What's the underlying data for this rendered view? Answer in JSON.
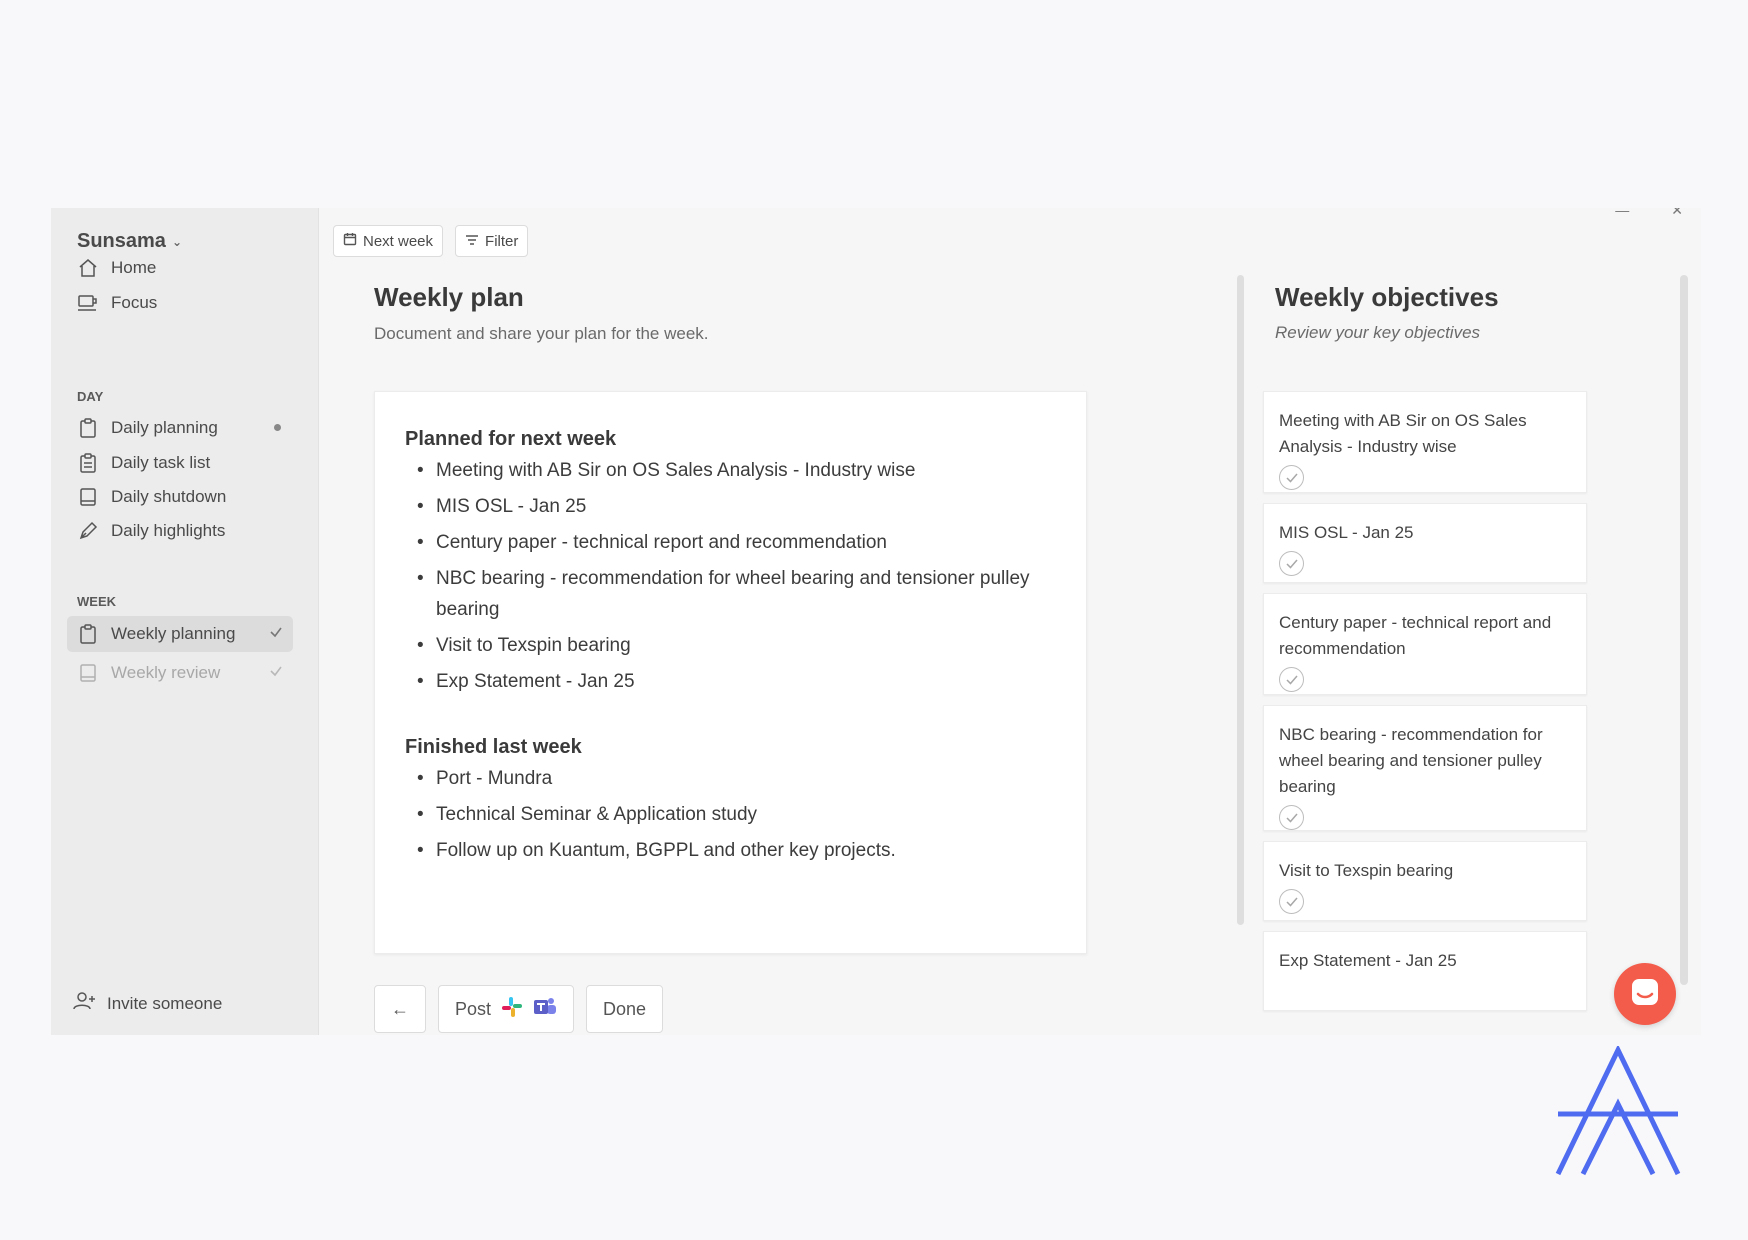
{
  "window": {
    "minimize_glyph": "—",
    "close_glyph": "✕"
  },
  "sidebar": {
    "brand": "Sunsama",
    "brand_chevron": "⌄",
    "items_top": [
      {
        "label": "Home",
        "icon": "home-icon"
      },
      {
        "label": "Focus",
        "icon": "cup-icon"
      }
    ],
    "day_label": "DAY",
    "day_items": [
      {
        "label": "Daily planning",
        "icon": "clipboard-icon",
        "badge": "dot"
      },
      {
        "label": "Daily task list",
        "icon": "checklist-icon"
      },
      {
        "label": "Daily shutdown",
        "icon": "book-icon"
      },
      {
        "label": "Daily highlights",
        "icon": "pen-icon"
      }
    ],
    "week_label": "WEEK",
    "week_items": [
      {
        "label": "Weekly planning",
        "icon": "clipboard-icon",
        "status": "check",
        "active": true
      },
      {
        "label": "Weekly review",
        "icon": "book-icon",
        "status": "check",
        "muted": true
      }
    ],
    "invite_label": "Invite someone"
  },
  "toolbar": {
    "next_week_label": "Next week",
    "filter_label": "Filter"
  },
  "plan": {
    "title": "Weekly plan",
    "subtitle": "Document and share your plan for the week.",
    "planned_heading": "Planned for next week",
    "planned_items": [
      "Meeting with AB Sir on OS Sales Analysis - Industry wise",
      "MIS OSL - Jan 25",
      "Century paper - technical report and recommendation",
      "NBC bearing - recommendation for wheel bearing and tensioner pulley bearing",
      "Visit to Texspin bearing",
      "Exp Statement - Jan 25"
    ],
    "finished_heading": "Finished last week",
    "finished_items": [
      "Port - Mundra",
      "Technical Seminar & Application study",
      "Follow up on Kuantum, BGPPL and other key projects."
    ]
  },
  "actions": {
    "back_glyph": "←",
    "post_label": "Post",
    "done_label": "Done"
  },
  "objectives": {
    "title": "Weekly objectives",
    "subtitle": "Review your key objectives",
    "items": [
      "Meeting with AB Sir on OS Sales Analysis - Industry wise",
      "MIS OSL - Jan 25",
      "Century paper - technical report and recommendation",
      "NBC bearing - recommendation for wheel bearing and tensioner pulley bearing",
      "Visit to Texspin bearing",
      "Exp Statement - Jan 25"
    ]
  },
  "colors": {
    "chat_button": "#f35b4a",
    "logo": "#4f6cf0",
    "slack": [
      "#36c5f0",
      "#2eb67d",
      "#ecb22e",
      "#e01e5a"
    ],
    "teams": "#5b5fc7"
  }
}
